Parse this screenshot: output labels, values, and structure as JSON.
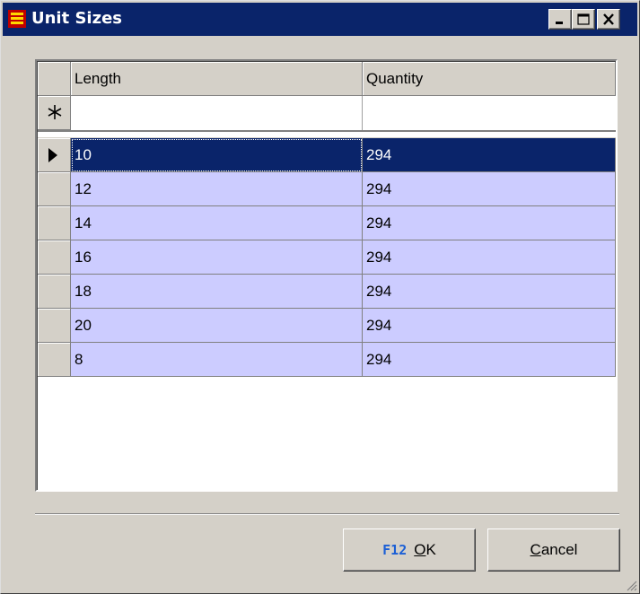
{
  "window": {
    "title": "Unit Sizes",
    "colors": {
      "titlebar": "#0a246a",
      "row_bg": "#ccccff",
      "selected_bg": "#0a246a",
      "face": "#d4d0c8"
    }
  },
  "titlebar_buttons": {
    "minimize_icon": "minimize-icon",
    "maximize_icon": "maximize-icon",
    "close_icon": "close-icon"
  },
  "grid": {
    "columns": [
      "Length",
      "Quantity"
    ],
    "new_row_icon": "asterisk-icon",
    "current_row_icon": "row-pointer-icon",
    "rows": [
      {
        "length": "10",
        "quantity": "294"
      },
      {
        "length": "12",
        "quantity": "294"
      },
      {
        "length": "14",
        "quantity": "294"
      },
      {
        "length": "16",
        "quantity": "294"
      },
      {
        "length": "18",
        "quantity": "294"
      },
      {
        "length": "20",
        "quantity": "294"
      },
      {
        "length": "8",
        "quantity": "294"
      }
    ],
    "selected_row_index": 0
  },
  "buttons": {
    "ok": {
      "fkey": "F12",
      "accel": "O",
      "rest": "K"
    },
    "cancel": {
      "accel": "C",
      "rest": "ancel"
    }
  }
}
